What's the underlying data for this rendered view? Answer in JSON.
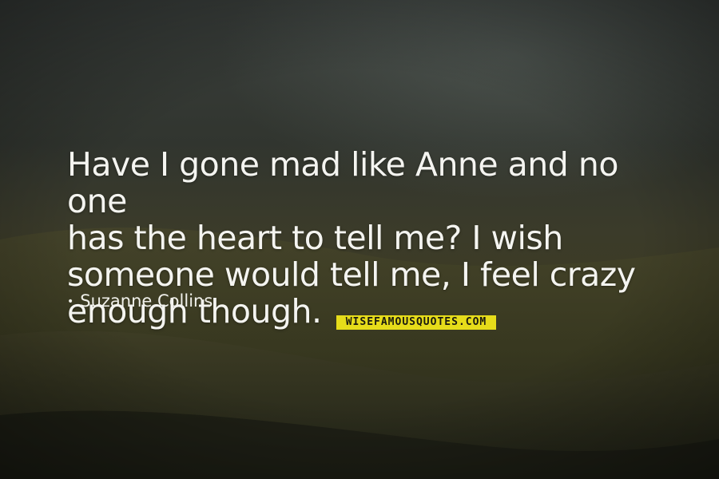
{
  "quote": {
    "text": "Have I gone mad like Anne and no one\nhas the heart to tell me? I wish\nsomeone would tell me, I feel crazy\nenough though."
  },
  "author": {
    "bullet": "•",
    "name": "Suzanne Collins"
  },
  "watermark": {
    "text": "WISEFAMOUSQUOTES.COM"
  },
  "colors": {
    "text": "#f4f4f0",
    "watermark_bg": "#e6dc1a",
    "sky": "#3a3f3c",
    "hill": "#3c3b24"
  }
}
